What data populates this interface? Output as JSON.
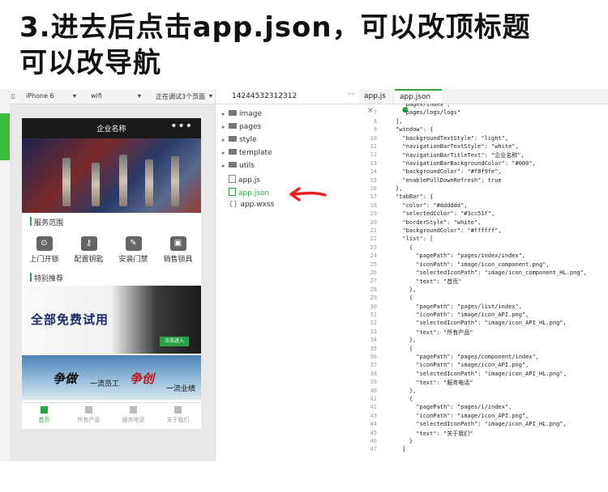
{
  "heading": {
    "line1": "3.进去后点击app.json，可以改顶标题",
    "line2": "可以改导航"
  },
  "simulator": {
    "device": "iPhone 6",
    "network": "wifi",
    "status": "正在调试3个页面",
    "nav_title": "企业名称",
    "nav_more": "•••",
    "section_services": "服务范围",
    "services": [
      "上门开锁",
      "配置钥匙",
      "安装门禁",
      "销售锁具"
    ],
    "section_featured": "特别推荐",
    "promo_text": "全部免费试用",
    "promo_button": "点击进入",
    "slogan": [
      "争做",
      "一流员工",
      "争创",
      "一流业绩"
    ],
    "tabs": [
      "首页",
      "所有产品",
      "服务电话",
      "关于我们"
    ]
  },
  "filetree": {
    "project": "14244532312312",
    "more": "···",
    "items": [
      {
        "name": "image",
        "type": "folder"
      },
      {
        "name": "pages",
        "type": "folder"
      },
      {
        "name": "style",
        "type": "folder"
      },
      {
        "name": "template",
        "type": "folder"
      },
      {
        "name": "utils",
        "type": "folder"
      },
      {
        "name": "app.js",
        "type": "file"
      },
      {
        "name": "app.json",
        "type": "file"
      },
      {
        "name": "app.wxss",
        "type": "file"
      }
    ]
  },
  "editor": {
    "tabs": [
      "app.js",
      "app.json"
    ],
    "close_glyph": "×",
    "lines": [
      {
        "n": "",
        "t": "  \"pages/index\","
      },
      {
        "n": "7",
        "t": "  \"pages/logs/logs\""
      },
      {
        "n": "8",
        "t": "],"
      },
      {
        "n": "9",
        "t": "\"window\": {"
      },
      {
        "n": "10",
        "t": "  \"backgroundTextStyle\": \"light\","
      },
      {
        "n": "11",
        "t": "  \"navigationBarTextStyle\": \"white\","
      },
      {
        "n": "12",
        "t": "  \"navigationBarTitleText\": \"企业名称\","
      },
      {
        "n": "13",
        "t": "  \"navigationBarBackgroundColor\": \"#000\","
      },
      {
        "n": "14",
        "t": "  \"backgroundColor\": \"#f8f9fe\","
      },
      {
        "n": "15",
        "t": "  \"enablePullDownRefresh\": true"
      },
      {
        "n": "16",
        "t": "},"
      },
      {
        "n": "17",
        "t": "\"tabBar\": {"
      },
      {
        "n": "18",
        "t": "  \"color\": \"#dddddd\","
      },
      {
        "n": "19",
        "t": "  \"selectedColor\": \"#3cc51f\","
      },
      {
        "n": "20",
        "t": "  \"borderStyle\": \"white\","
      },
      {
        "n": "21",
        "t": "  \"backgroundColor\": \"#ffffff\","
      },
      {
        "n": "22",
        "t": "  \"list\": ["
      },
      {
        "n": "23",
        "t": "    {"
      },
      {
        "n": "24",
        "t": "      \"pagePath\": \"pages/index/index\","
      },
      {
        "n": "25",
        "t": "      \"iconPath\": \"image/icon_component.png\","
      },
      {
        "n": "26",
        "t": "      \"selectedIconPath\": \"image/icon_component_HL.png\","
      },
      {
        "n": "27",
        "t": "      \"text\": \"首页\""
      },
      {
        "n": "28",
        "t": "    },"
      },
      {
        "n": "29",
        "t": "    {"
      },
      {
        "n": "30",
        "t": "      \"pagePath\": \"pages/list/index\","
      },
      {
        "n": "31",
        "t": "      \"iconPath\": \"image/icon_API.png\","
      },
      {
        "n": "32",
        "t": "      \"selectedIconPath\": \"image/icon_API_HL.png\","
      },
      {
        "n": "33",
        "t": "      \"text\": \"所有产品\""
      },
      {
        "n": "34",
        "t": "    },"
      },
      {
        "n": "35",
        "t": "    {"
      },
      {
        "n": "36",
        "t": "      \"pagePath\": \"pages/component/index\","
      },
      {
        "n": "37",
        "t": "      \"iconPath\": \"image/icon_API.png\","
      },
      {
        "n": "38",
        "t": "      \"selectedIconPath\": \"image/icon_API_HL.png\","
      },
      {
        "n": "39",
        "t": "      \"text\": \"服务电话\""
      },
      {
        "n": "40",
        "t": "    },"
      },
      {
        "n": "41",
        "t": "    {"
      },
      {
        "n": "42",
        "t": "      \"pagePath\": \"pages/i/index\","
      },
      {
        "n": "43",
        "t": "      \"iconPath\": \"image/icon_API.png\","
      },
      {
        "n": "44",
        "t": "      \"selectedIconPath\": \"image/icon_API_HL.png\","
      },
      {
        "n": "45",
        "t": "      \"text\": \"关于我们\""
      },
      {
        "n": "46",
        "t": "    }"
      },
      {
        "n": "47",
        "t": "  ]"
      }
    ]
  },
  "colors": {
    "accent": "#2ba245",
    "annotation_arrow": "#e8231f"
  }
}
